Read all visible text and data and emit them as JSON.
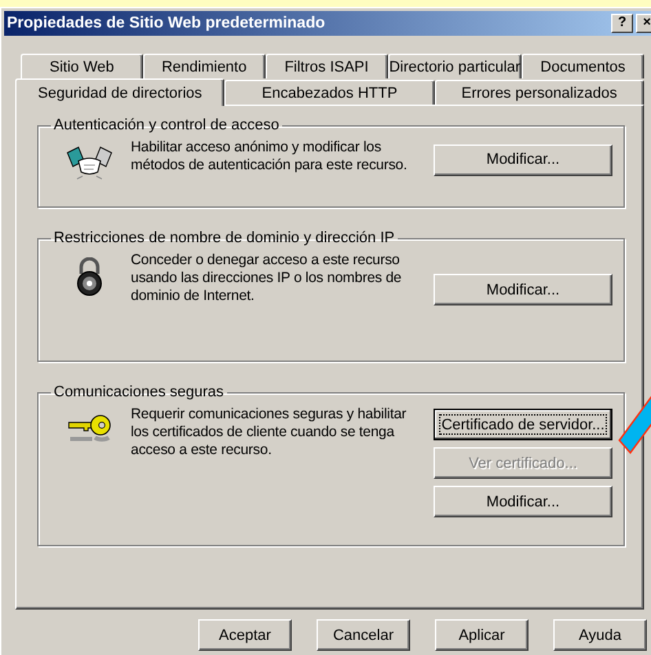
{
  "window": {
    "title": "Propiedades de Sitio Web predeterminado",
    "help_button": "?",
    "close_button": "×"
  },
  "tab_rows": [
    [
      {
        "label": "Sitio Web",
        "selected": false
      },
      {
        "label": "Rendimiento",
        "selected": false
      },
      {
        "label": "Filtros ISAPI",
        "selected": false
      },
      {
        "label": "Directorio particular",
        "selected": false
      },
      {
        "label": "Documentos",
        "selected": false
      }
    ],
    [
      {
        "label": "Seguridad de directorios",
        "selected": true
      },
      {
        "label": "Encabezados HTTP",
        "selected": false
      },
      {
        "label": "Errores personalizados",
        "selected": false
      }
    ]
  ],
  "groups": [
    {
      "title": "Autenticación y control de acceso",
      "kind": "handshake",
      "description": "Habilitar acceso anónimo y modificar los métodos de autenticación para este recurso.",
      "buttons": [
        {
          "label": "Modificar...",
          "disabled": false,
          "focused": false
        }
      ]
    },
    {
      "title": "Restricciones de nombre de dominio y dirección IP",
      "kind": "lock",
      "description": "Conceder o denegar acceso a este recurso usando las direcciones IP o los nombres de dominio de Internet.",
      "buttons": [
        {
          "label": "Modificar...",
          "disabled": false,
          "focused": false
        }
      ]
    },
    {
      "title": "Comunicaciones seguras",
      "kind": "key",
      "description": "Requerir comunicaciones seguras y habilitar los certificados de cliente cuando se tenga acceso a este recurso.",
      "buttons": [
        {
          "label": "Certificado de servidor...",
          "disabled": false,
          "focused": true
        },
        {
          "label": "Ver certificado...",
          "disabled": true,
          "focused": false
        },
        {
          "label": "Modificar...",
          "disabled": false,
          "focused": false
        }
      ]
    }
  ],
  "dialog_buttons": [
    "Aceptar",
    "Cancelar",
    "Aplicar",
    "Ayuda"
  ],
  "annotation": {
    "kind": "arrow"
  }
}
